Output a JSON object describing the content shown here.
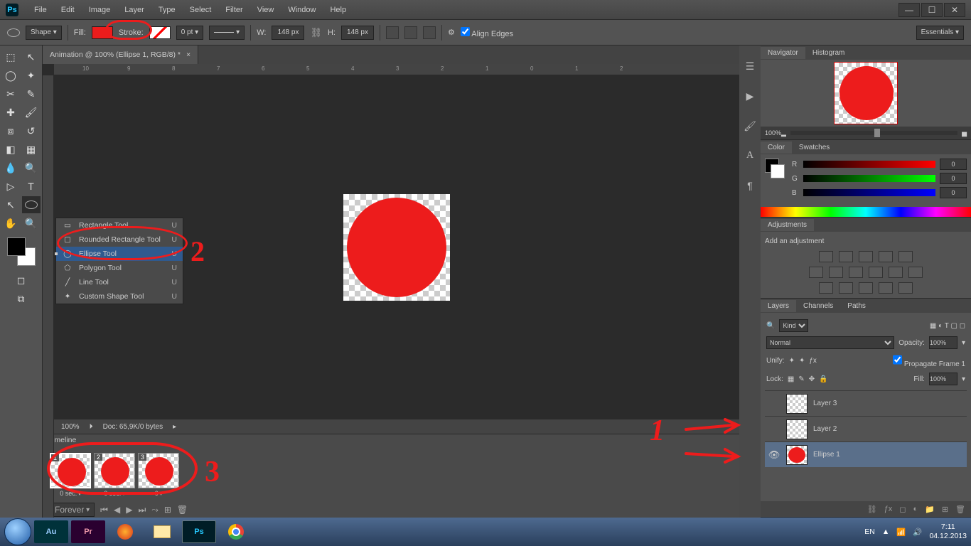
{
  "app": {
    "name": "Ps"
  },
  "menu": [
    "File",
    "Edit",
    "Image",
    "Layer",
    "Type",
    "Select",
    "Filter",
    "View",
    "Window",
    "Help"
  ],
  "options": {
    "mode": "Shape",
    "fill_label": "Fill:",
    "fill_color": "#ed1c1c",
    "stroke_label": "Stroke:",
    "stroke_weight": "0 pt",
    "w_label": "W:",
    "width": "148 px",
    "h_label": "H:",
    "height": "148 px",
    "align_edges": "Align Edges",
    "workspace": "Essentials"
  },
  "document": {
    "tab_title": "Animation @ 100% (Ellipse 1, RGB/8) *",
    "zoom": "100%",
    "doc_info": "Doc: 65,9K/0 bytes"
  },
  "shape_tools": [
    {
      "label": "Rectangle Tool",
      "key": "U"
    },
    {
      "label": "Rounded Rectangle Tool",
      "key": "U"
    },
    {
      "label": "Ellipse Tool",
      "key": "U",
      "selected": true
    },
    {
      "label": "Polygon Tool",
      "key": "U"
    },
    {
      "label": "Line Tool",
      "key": "U"
    },
    {
      "label": "Custom Shape Tool",
      "key": "U"
    }
  ],
  "timeline": {
    "title": "Timeline",
    "frames": [
      {
        "num": "1",
        "delay": "0 sec.",
        "selected": true
      },
      {
        "num": "2",
        "delay": "0 sec."
      },
      {
        "num": "3",
        "delay": "0"
      }
    ],
    "loop": "Forever"
  },
  "panels": {
    "navigator": {
      "tabs": [
        "Navigator",
        "Histogram"
      ],
      "zoom": "100%"
    },
    "color": {
      "tabs": [
        "Color",
        "Swatches"
      ],
      "r": "0",
      "g": "0",
      "b": "0"
    },
    "adjustments": {
      "tabs": [
        "Adjustments"
      ],
      "hint": "Add an adjustment"
    },
    "layers": {
      "tabs": [
        "Layers",
        "Channels",
        "Paths"
      ],
      "kind": "Kind",
      "blend": "Normal",
      "opacity_label": "Opacity:",
      "opacity": "100%",
      "unify": "Unify:",
      "propagate": "Propagate Frame 1",
      "lock": "Lock:",
      "fill_label": "Fill:",
      "fill": "100%",
      "items": [
        {
          "name": "Layer 3",
          "visible": false
        },
        {
          "name": "Layer 2",
          "visible": false
        },
        {
          "name": "Ellipse 1",
          "visible": true,
          "red": true,
          "selected": true
        }
      ]
    }
  },
  "annotations": {
    "n1": "1",
    "n2": "2",
    "n3": "3"
  },
  "taskbar": {
    "apps": [
      {
        "label": "Au",
        "bg": "#00323a",
        "fg": "#9cf"
      },
      {
        "label": "Pr",
        "bg": "#2a0030",
        "fg": "#e9a"
      },
      {
        "label": "",
        "icon": "firefox"
      },
      {
        "label": "",
        "icon": "explorer"
      },
      {
        "label": "Ps",
        "bg": "#001d26",
        "fg": "#26c9ff",
        "active": true
      },
      {
        "label": "",
        "icon": "chrome"
      }
    ],
    "lang": "EN",
    "time": "7:11",
    "date": "04.12.2013"
  }
}
